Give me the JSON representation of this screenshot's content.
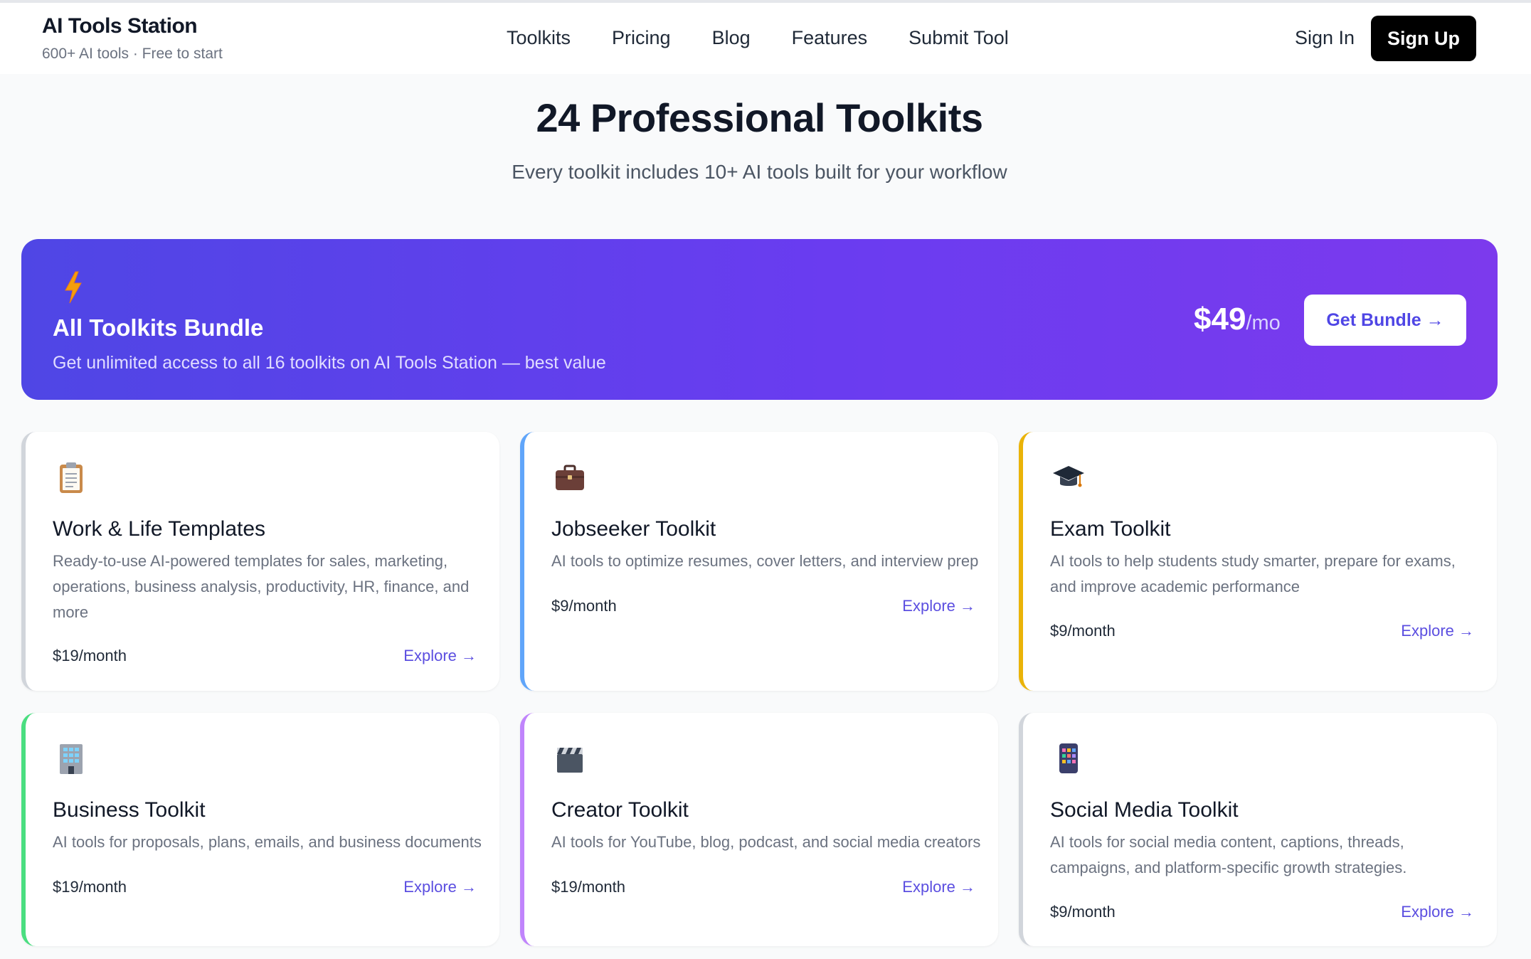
{
  "header": {
    "brand": "AI Tools Station",
    "tagline": "600+ AI tools · Free to start",
    "nav": [
      "Toolkits",
      "Pricing",
      "Blog",
      "Features",
      "Submit Tool"
    ],
    "sign_in": "Sign In",
    "sign_up": "Sign Up"
  },
  "hero": {
    "title": "24 Professional Toolkits",
    "subtitle": "Every toolkit includes 10+ AI tools built for your workflow"
  },
  "bundle": {
    "icon": "lightning-icon",
    "title": "All Toolkits Bundle",
    "description": "Get unlimited access to all 16 toolkits on AI Tools Station — best value",
    "price": "$49",
    "per": "/mo",
    "button": "Get Bundle →"
  },
  "cards": [
    {
      "icon": "clipboard-icon",
      "title": "Work & Life Templates",
      "description": "Ready-to-use AI-powered templates for sales, marketing, operations, business analysis, productivity, HR, finance, and more",
      "price": "$19/month",
      "explore": "Explore →",
      "accent": "#d1d5db"
    },
    {
      "icon": "briefcase-icon",
      "title": "Jobseeker Toolkit",
      "description": "AI tools to optimize resumes, cover letters, and interview prep",
      "price": "$9/month",
      "explore": "Explore →",
      "accent": "#60a5fa"
    },
    {
      "icon": "graduation-cap-icon",
      "title": "Exam Toolkit",
      "description": "AI tools to help students study smarter, prepare for exams, and improve academic performance",
      "price": "$9/month",
      "explore": "Explore →",
      "accent": "#eab308"
    },
    {
      "icon": "office-building-icon",
      "title": "Business Toolkit",
      "description": "AI tools for proposals, plans, emails, and business documents",
      "price": "$19/month",
      "explore": "Explore →",
      "accent": "#4ade80"
    },
    {
      "icon": "clapperboard-icon",
      "title": "Creator Toolkit",
      "description": "AI tools for YouTube, blog, podcast, and social media creators",
      "price": "$19/month",
      "explore": "Explore →",
      "accent": "#c084fc"
    },
    {
      "icon": "phone-apps-icon",
      "title": "Social Media Toolkit",
      "description": "AI tools for social media content, captions, threads, campaigns, and platform-specific growth strategies.",
      "price": "$9/month",
      "explore": "Explore →",
      "accent": "#d1d5db"
    }
  ]
}
